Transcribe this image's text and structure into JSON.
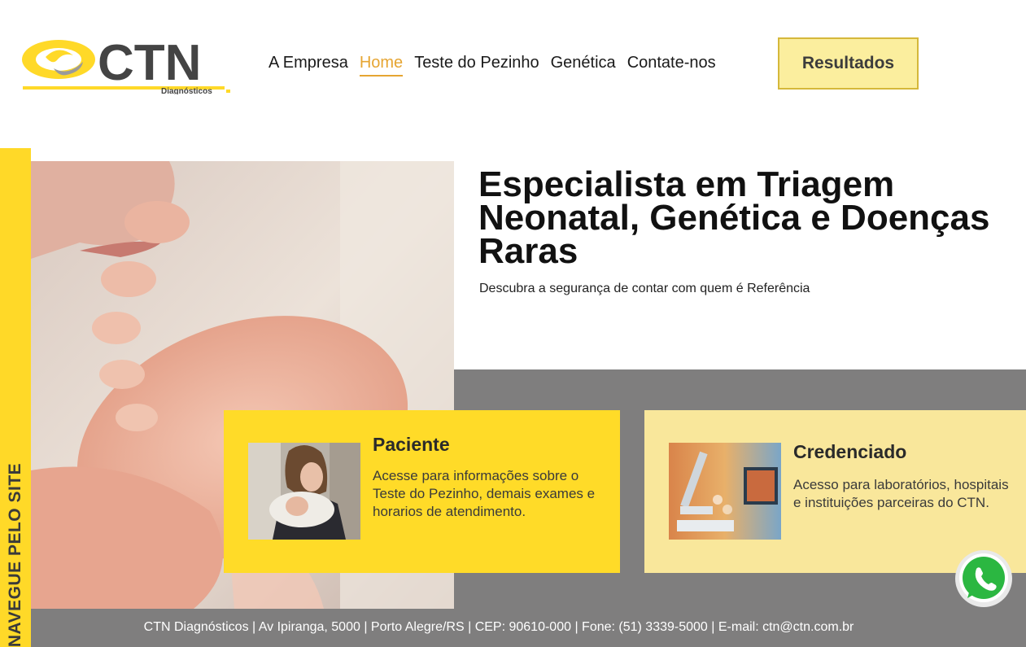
{
  "brand": {
    "name": "CTN",
    "tagline": "Diagnósticos",
    "colors": {
      "yellow": "#ffd928",
      "pale_yellow": "#f9e79b",
      "grey": "#7f7e7e",
      "accent": "#e6a532"
    }
  },
  "nav": {
    "items": [
      {
        "label": "A Empresa"
      },
      {
        "label": "Home",
        "active": true
      },
      {
        "label": "Teste do Pezinho"
      },
      {
        "label": "Genética"
      },
      {
        "label": "Contate-nos"
      }
    ],
    "results_button": "Resultados"
  },
  "side_rail": {
    "label": "NAVEGUE PELO SITE"
  },
  "hero": {
    "title": "Especialista em Triagem Neonatal, Genética e Doenças Raras",
    "subtitle": "Descubra a segurança de contar com quem é Referência"
  },
  "cards": [
    {
      "title": "Paciente",
      "text": "Acesse para informações sobre o Teste do Pezinho, demais exames e horarios de atendimento."
    },
    {
      "title": "Credenciado",
      "text": "Acesso para laboratórios, hospitais e instituições parceiras do CTN."
    }
  ],
  "footer": {
    "text": "CTN Diagnósticos | Av Ipiranga, 5000 | Porto Alegre/RS | CEP: 90610-000 | Fone: (51) 3339-5000 | E-mail: ctn@ctn.com.br"
  },
  "icons": {
    "whatsapp": "whatsapp-icon"
  }
}
